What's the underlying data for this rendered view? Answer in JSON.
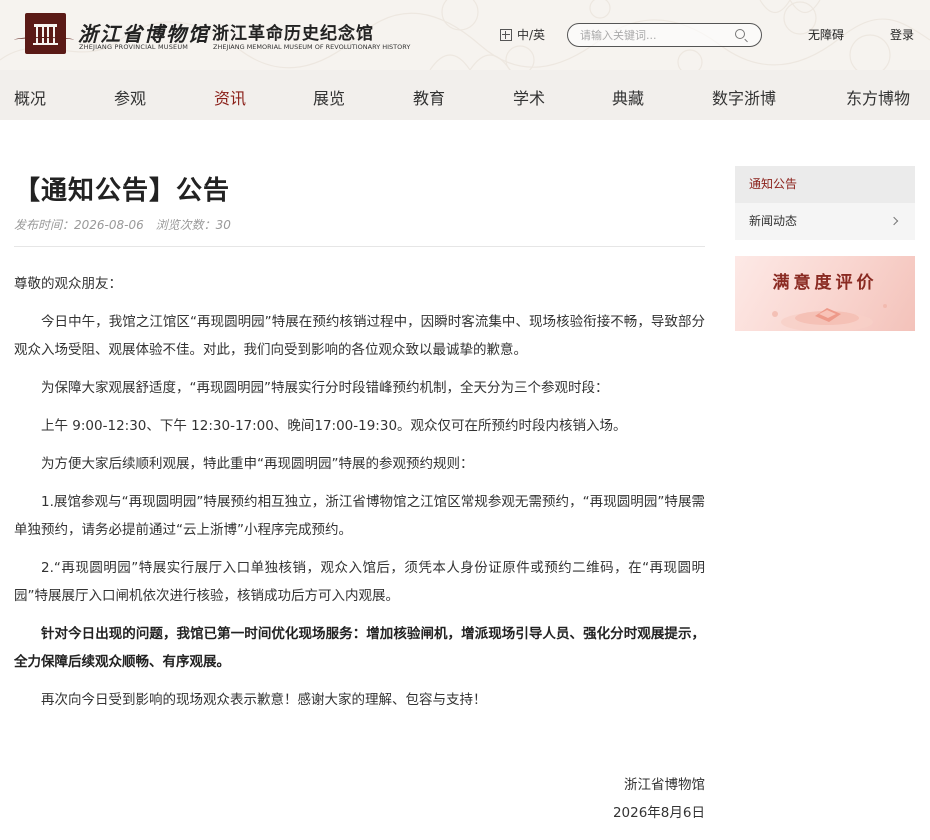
{
  "header": {
    "brand_primary_cn": "浙江省博物馆",
    "brand_primary_en": "ZHEJIANG PROVINCIAL MUSEUM",
    "brand_secondary_cn": "浙江革命历史纪念馆",
    "brand_secondary_en": "ZHEJIANG MEMORIAL MUSEUM OF REVOLUTIONARY HISTORY",
    "language_label": "中/英",
    "search_placeholder": "请输入关键词...",
    "accessibility_label": "无障碍",
    "login_label": "登录"
  },
  "nav": {
    "items": [
      {
        "label": "概况"
      },
      {
        "label": "参观"
      },
      {
        "label": "资讯"
      },
      {
        "label": "展览"
      },
      {
        "label": "教育"
      },
      {
        "label": "学术"
      },
      {
        "label": "典藏"
      },
      {
        "label": "数字浙博"
      },
      {
        "label": "东方博物"
      }
    ],
    "active_index": 2
  },
  "article": {
    "title": "【通知公告】公告",
    "publish_time": "发布时间：2026-08-06",
    "view_count": "浏览次数：30",
    "greeting": "尊敬的观众朋友：",
    "paragraphs": [
      "今日中午，我馆之江馆区“再现圆明园”特展在预约核销过程中，因瞬时客流集中、现场核验衔接不畅，导致部分观众入场受阻、观展体验不佳。对此，我们向受到影响的各位观众致以最诚挚的歉意。",
      "为保障大家观展舒适度，“再现圆明园”特展实行分时段错峰预约机制，全天分为三个参观时段：",
      "上午 9:00-12:30、下午 12:30-17:00、晚间17:00-19:30。观众仅可在所预约时段内核销入场。",
      "为方便大家后续顺利观展，特此重申“再现圆明园”特展的参观预约规则：",
      "1.展馆参观与“再现圆明园”特展预约相互独立，浙江省博物馆之江馆区常规参观无需预约，“再现圆明园”特展需单独预约，请务必提前通过“云上浙博”小程序完成预约。",
      "2.“再现圆明园”特展实行展厅入口单独核销，观众入馆后，须凭本人身份证原件或预约二维码，在“再现圆明园”特展展厅入口闸机依次进行核验，核销成功后方可入内观展。",
      "针对今日出现的问题，我馆已第一时间优化现场服务：增加核验闸机，增派现场引导人员、强化分时观展提示，全力保障后续观众顺畅、有序观展。",
      "再次向今日受到影响的现场观众表示歉意！感谢大家的理解、包容与支持！"
    ],
    "signature_org": "浙江省博物馆",
    "signature_date": "2026年8月6日"
  },
  "sidebar": {
    "menu": [
      {
        "label": "通知公告"
      },
      {
        "label": "新闻动态"
      }
    ],
    "banner_text": "满意度评价"
  },
  "colors": {
    "accent": "#8a1f18",
    "header_bg": "#f6f3ef",
    "nav_bg": "#f2efec"
  }
}
